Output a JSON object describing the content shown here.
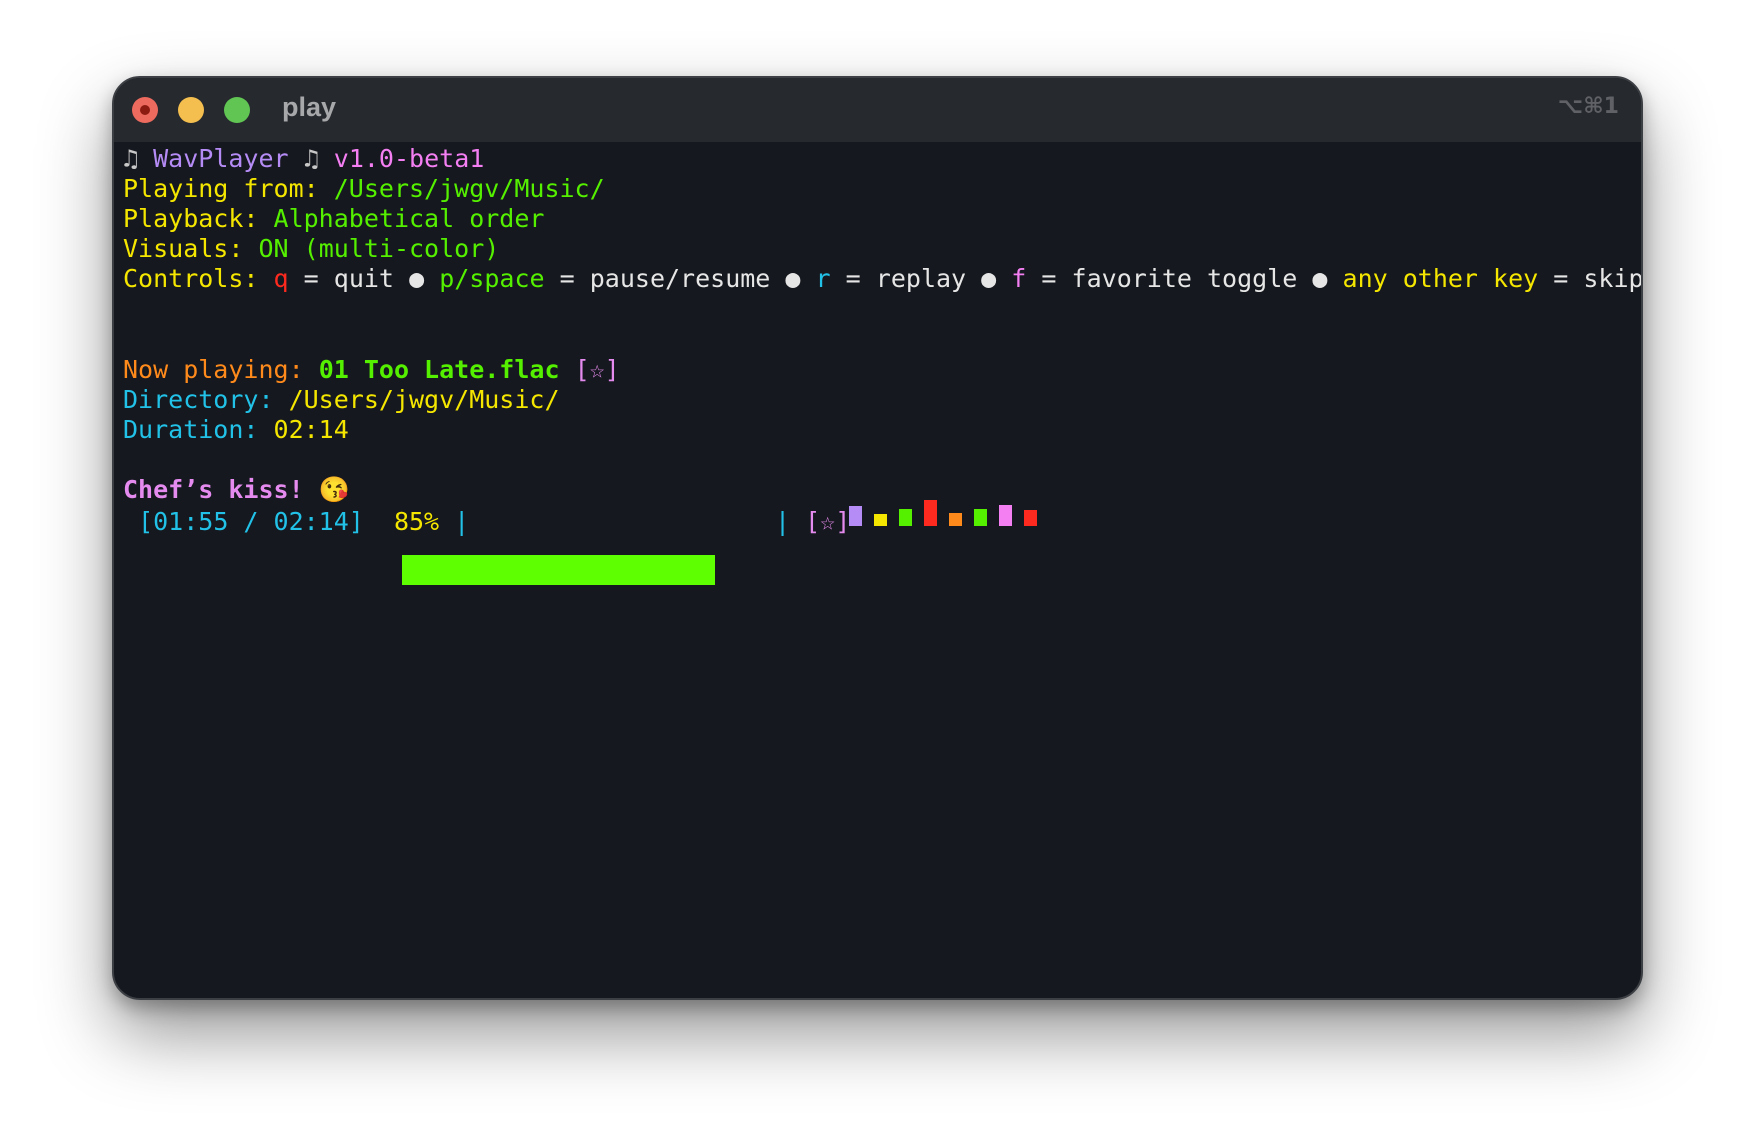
{
  "window": {
    "title": "play",
    "shortcut": "⌥⌘1"
  },
  "header": {
    "note_icon": "♫",
    "app_name": "WavPlayer",
    "version": "v1.0-beta1",
    "playing_from_label": "Playing from:",
    "playing_from_value": "/Users/jwgv/Music/",
    "playback_label": "Playback:",
    "playback_value": "Alphabetical order",
    "visuals_label": "Visuals:",
    "visuals_value": "ON (multi-color)"
  },
  "controls": {
    "label": "Controls:",
    "separator": "●",
    "eq": "=",
    "items": [
      {
        "key": "q",
        "action": "quit",
        "key_color": "#ff2a1f"
      },
      {
        "key": "p/space",
        "action": "pause/resume",
        "key_color": "#55f000"
      },
      {
        "key": "r",
        "action": "replay",
        "key_color": "#22c2e8"
      },
      {
        "key": "f",
        "action": "favorite toggle",
        "key_color": "#f47ff3"
      },
      {
        "key": "any other key",
        "action": "skip",
        "key_color": "#f5e600"
      }
    ]
  },
  "now_playing": {
    "label": "Now playing:",
    "track": "01 Too Late.flac",
    "favorite_marker": "[☆]",
    "directory_label": "Directory:",
    "directory_value": "/Users/jwgv/Music/",
    "duration_label": "Duration:",
    "duration_value": "02:14"
  },
  "message": {
    "text": "Chef’s kiss!",
    "emoji": "😘"
  },
  "status": {
    "time_display": "[01:55 / 02:14]",
    "percent_text": "85%",
    "progress": 0.85,
    "bar_left": "|",
    "bar_right": "|",
    "favorite_marker": "[☆]"
  },
  "visualizer": {
    "bars": [
      {
        "level": 0.75,
        "color": "#b58cf5"
      },
      {
        "level": 0.45,
        "color": "#f5e600"
      },
      {
        "level": 0.65,
        "color": "#55f000"
      },
      {
        "level": 1.0,
        "color": "#ff2a1f"
      },
      {
        "level": 0.5,
        "color": "#ff8a1c"
      },
      {
        "level": 0.65,
        "color": "#55f000"
      },
      {
        "level": 0.8,
        "color": "#f47ff3"
      },
      {
        "level": 0.6,
        "color": "#ff2a1f"
      }
    ]
  }
}
